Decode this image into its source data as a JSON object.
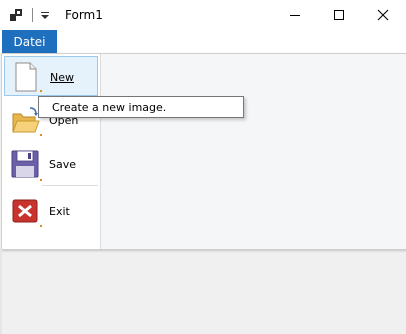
{
  "window": {
    "title": "Form1"
  },
  "ribbon": {
    "tab_file_label": "Datei"
  },
  "app_menu": {
    "items": [
      {
        "label": "New",
        "icon": "new-document-icon",
        "shortcut_underline": "N"
      },
      {
        "label": "Open",
        "icon": "open-folder-icon"
      },
      {
        "label": "Save",
        "icon": "save-floppy-icon"
      },
      {
        "label": "Exit",
        "icon": "exit-icon"
      }
    ]
  },
  "tooltip": {
    "text": "Create a new image."
  },
  "colors": {
    "tab_active_bg": "#1f6fbf",
    "hover_bg": "#e5f1fb",
    "hover_border": "#99c9ef",
    "save_icon": "#6b5fa8",
    "exit_icon": "#c8342d"
  }
}
